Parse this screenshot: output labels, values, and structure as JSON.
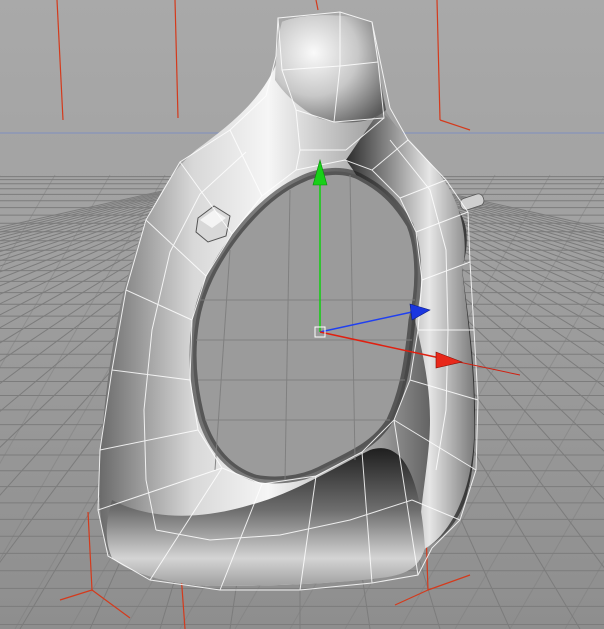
{
  "viewport": {
    "type": "3d-perspective-view",
    "object": "organic-ring-mesh",
    "shading": "gouraud-with-wireframe-cage",
    "colors": {
      "background_top": "#a8a8a8",
      "background_bottom": "#8f8f8f",
      "horizon_line": "#7f8fb8",
      "grid_line": "#7a7a7a",
      "grid_major": "#6a6a6a",
      "bbox_corner": "#d84020",
      "axis_x": "#e02010",
      "axis_y": "#10d010",
      "axis_z": "#1030e0",
      "wire_cage": "#ffffff",
      "mesh_light": "#f4f4f4",
      "mesh_mid": "#b8b8b8",
      "mesh_dark": "#2a2a2a"
    },
    "gizmo": {
      "type": "move-tool",
      "axes": [
        "x-axis",
        "y-axis",
        "z-axis"
      ]
    }
  }
}
